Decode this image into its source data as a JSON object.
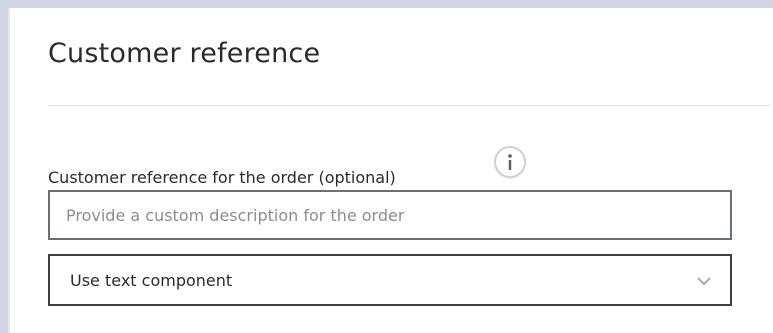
{
  "section": {
    "title": "Customer reference"
  },
  "field": {
    "label": "Customer reference for the order (optional)",
    "info_icon": "info-icon",
    "input": {
      "value": "",
      "placeholder": "Provide a custom description for the order"
    },
    "select": {
      "selected": "Use text component",
      "icon": "chevron-down-icon"
    }
  },
  "colors": {
    "frame_border": "#d3d7e3",
    "input_border": "#6b6f78",
    "select_border": "#3c3f45",
    "placeholder_text": "#8a8d94",
    "divider": "#d9dbe0"
  }
}
